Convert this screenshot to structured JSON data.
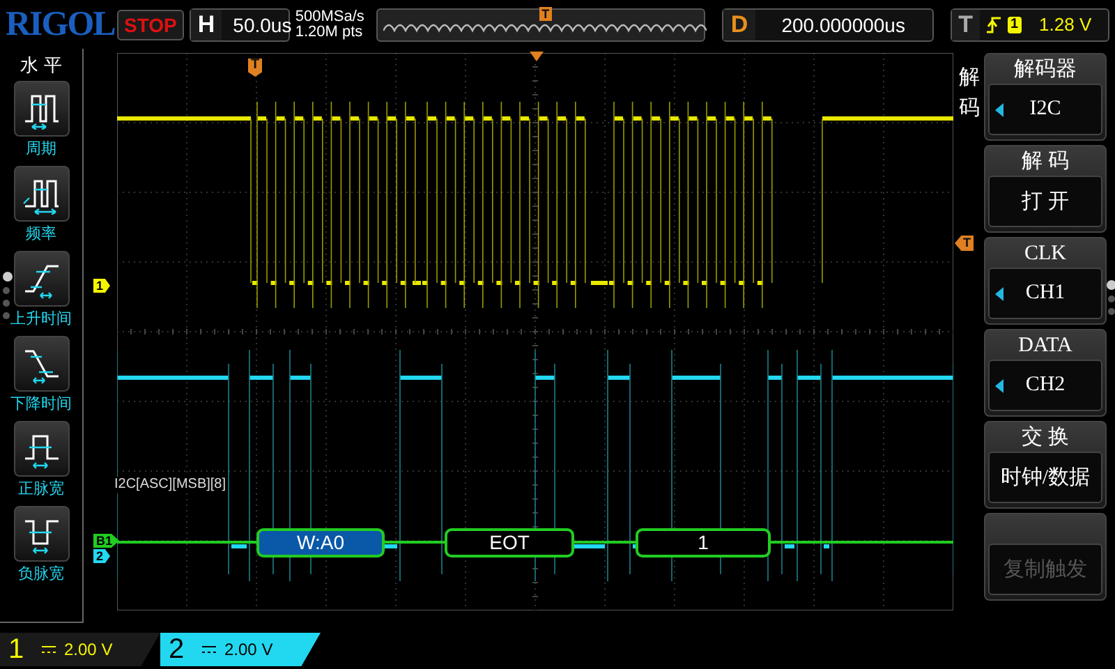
{
  "top_bar": {
    "logo": "RIGOL",
    "run_state": "STOP",
    "timebase": {
      "label": "H",
      "value": "50.0us"
    },
    "sample_rate": "500MSa/s",
    "memory_depth": "1.20M pts",
    "memory_marker": "T",
    "delay": {
      "label": "D",
      "value": "200.000000us"
    },
    "trigger": {
      "label": "T",
      "source": "1",
      "level": "1.28 V"
    }
  },
  "left_menu": {
    "title": "水 平",
    "items": [
      {
        "label": "周期",
        "kind": "period"
      },
      {
        "label": "频率",
        "kind": "frequency"
      },
      {
        "label": "上升时间",
        "kind": "rise"
      },
      {
        "label": "下降时间",
        "kind": "fall"
      },
      {
        "label": "正脉宽",
        "kind": "pos_width"
      },
      {
        "label": "负脉宽",
        "kind": "neg_width"
      }
    ],
    "pages": [
      {
        "selected": true
      },
      {
        "selected": false
      },
      {
        "selected": false
      },
      {
        "selected": false
      }
    ]
  },
  "waveform_area": {
    "trigger_marker": "T",
    "right_trigger_marker": "T",
    "channel_markers": [
      {
        "label": "1",
        "kind": "ch1",
        "color": "#f5f500"
      },
      {
        "label": "B1",
        "kind": "bus",
        "color": "#22cc22"
      },
      {
        "label": "2",
        "kind": "ch2",
        "color": "#22d8f0"
      }
    ],
    "decode_label": "I2C[ASC][MSB][8]",
    "decode_packets": [
      {
        "text": "W:A0",
        "kind": "address"
      },
      {
        "text": "EOT",
        "kind": "data"
      },
      {
        "text": "1",
        "kind": "data"
      }
    ]
  },
  "right_menu": {
    "title": "解码",
    "items": [
      {
        "heading": "解码器",
        "value": "I2C",
        "has_arrow": true,
        "disabled": false
      },
      {
        "heading": "解 码",
        "value": "打 开",
        "has_arrow": false,
        "disabled": false
      },
      {
        "heading": "CLK",
        "value": "CH1",
        "has_arrow": true,
        "disabled": false
      },
      {
        "heading": "DATA",
        "value": "CH2",
        "has_arrow": true,
        "disabled": false
      },
      {
        "heading": "交 换",
        "value": "时钟/数据",
        "has_arrow": false,
        "disabled": false
      },
      {
        "value": "复制触发",
        "has_arrow": false,
        "disabled": true
      }
    ],
    "pages": [
      {
        "selected": true
      },
      {
        "selected": false
      },
      {
        "selected": false
      }
    ]
  },
  "bottom_bar": {
    "channels": [
      {
        "number": "1",
        "scale": "2.00 V",
        "selected": false,
        "color": "#f5f500"
      },
      {
        "number": "2",
        "scale": "2.00 V",
        "selected": true,
        "color": "#22d8f0"
      }
    ]
  }
}
